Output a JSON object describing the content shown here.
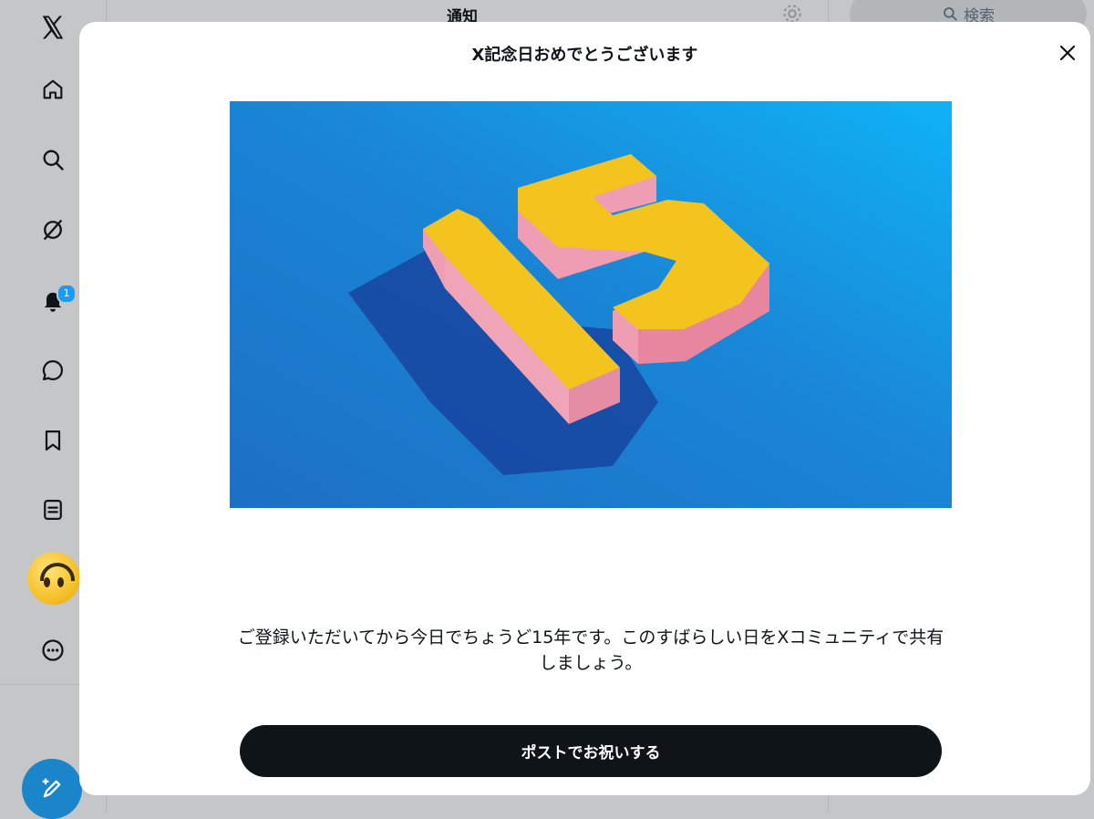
{
  "background": {
    "header_title": "通知",
    "search_label": "検索",
    "notification_badge": "1",
    "nav_icons": [
      "x-logo-icon",
      "home-icon",
      "search-icon",
      "grok-icon",
      "bell-icon",
      "message-icon",
      "bookmark-icon",
      "list-icon",
      "avatar",
      "more-icon",
      "compose-icon"
    ]
  },
  "modal": {
    "title": "X記念日おめでとうございます",
    "hero_image": {
      "number_shown": "15",
      "background_color": "#1a7fd0",
      "number_top_color": "#f2c41d",
      "number_side_color": "#ef9db2"
    },
    "message": "ご登録いただいてから今日でちょうど15年です。このすばらしい日をXコミュニティで共有しましょう。",
    "button_label": "ポストでお祝いする"
  },
  "colors": {
    "accent": "#1d9bf0",
    "button": "#0f1419",
    "overlay": "#c4c6c7"
  }
}
